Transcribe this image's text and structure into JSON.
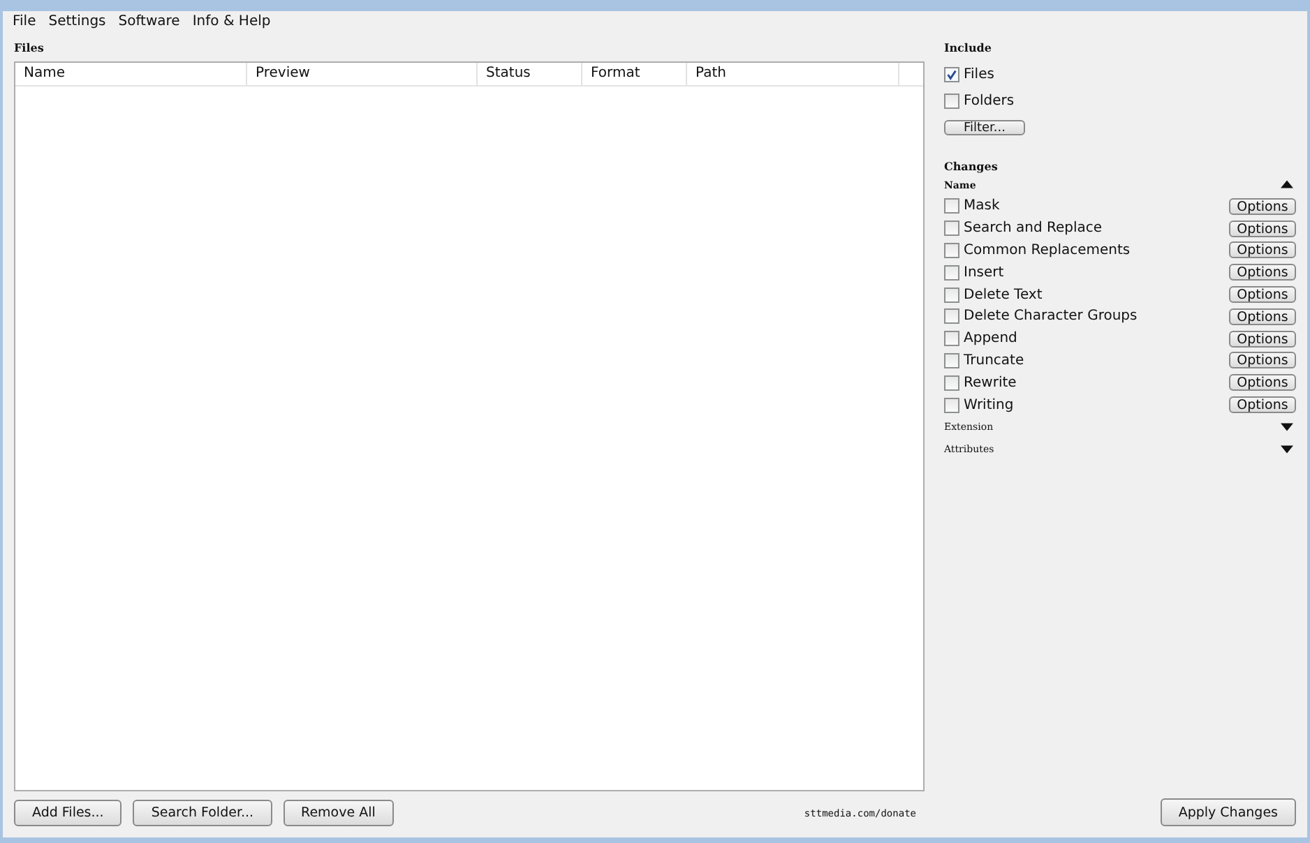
{
  "menu": [
    "File",
    "Settings",
    "Software",
    "Info & Help"
  ],
  "files": {
    "title": "Files",
    "columns": [
      "Name",
      "Preview",
      "Status",
      "Format",
      "Path"
    ]
  },
  "include": {
    "title": "Include",
    "options": [
      {
        "label": "Files",
        "checked": true
      },
      {
        "label": "Folders",
        "checked": false
      }
    ],
    "filter_button": "Filter..."
  },
  "changes": {
    "title": "Changes",
    "sections": [
      {
        "title": "Name",
        "expanded": true,
        "items": [
          {
            "label": "Mask",
            "checked": false,
            "button": "Options"
          },
          {
            "label": "Search and Replace",
            "checked": false,
            "button": "Options"
          },
          {
            "label": "Common Replacements",
            "checked": false,
            "button": "Options"
          },
          {
            "label": "Insert",
            "checked": false,
            "button": "Options"
          },
          {
            "label": "Delete Text",
            "checked": false,
            "button": "Options"
          },
          {
            "label": "Delete Character Groups",
            "checked": false,
            "button": "Options"
          },
          {
            "label": "Append",
            "checked": false,
            "button": "Options"
          },
          {
            "label": "Truncate",
            "checked": false,
            "button": "Options"
          },
          {
            "label": "Rewrite",
            "checked": false,
            "button": "Options"
          },
          {
            "label": "Writing",
            "checked": false,
            "button": "Options"
          }
        ]
      },
      {
        "title": "Extension",
        "expanded": false
      },
      {
        "title": "Attributes",
        "expanded": false
      }
    ]
  },
  "bottom_buttons": [
    "Add Files...",
    "Search Folder...",
    "Remove All"
  ],
  "donate_link": "sttmedia.com/donate",
  "apply_button": "Apply Changes"
}
